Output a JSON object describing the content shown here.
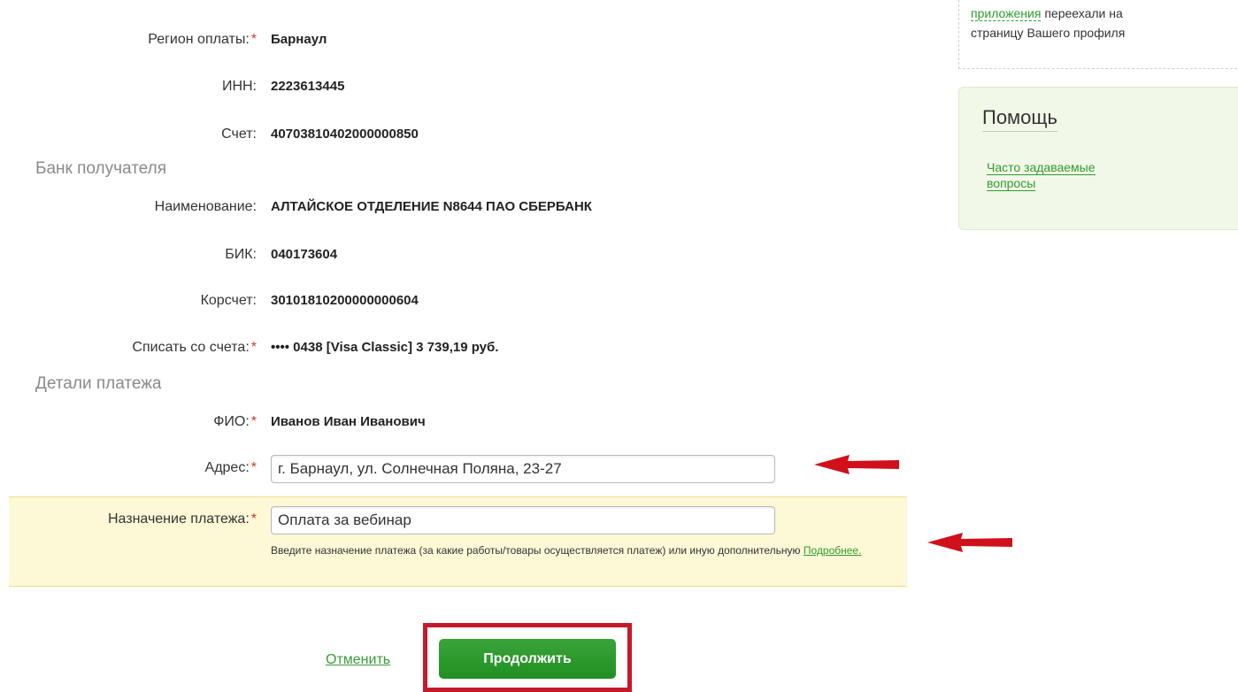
{
  "recipient": {
    "region_label": "Регион оплаты:",
    "region_value": "Барнаул",
    "inn_label": "ИНН:",
    "inn_value": "2223613445",
    "account_label": "Счет:",
    "account_value": "40703810402000000850"
  },
  "bank_section_title": "Банк получателя",
  "bank": {
    "name_label": "Наименование:",
    "name_value": "АЛТАЙСКОЕ ОТДЕЛЕНИЕ N8644 ПАО СБЕРБАНК",
    "bik_label": "БИК:",
    "bik_value": "040173604",
    "corr_label": "Корсчет:",
    "corr_value": "30101810200000000604",
    "debit_label": "Списать со счета:",
    "debit_value": "•••• 0438  [Visa Classic] 3 739,19   руб."
  },
  "details_section_title": "Детали платежа",
  "details": {
    "fio_label": "ФИО:",
    "fio_value": "Иванов Иван Иванович",
    "address_label": "Адрес:",
    "address_value": "г. Барнаул, ул. Солнечная Поляна, 23-27",
    "purpose_label": "Назначение платежа:",
    "purpose_value": "Оплата за вебинар",
    "purpose_hint": "Введите назначение платежа (за какие работы/товары осуществляется платеж) или иную дополнительную",
    "purpose_hint_link": "Подробнее."
  },
  "required_mark": "*",
  "actions": {
    "cancel": "Отменить",
    "continue": "Продолжить"
  },
  "sidebar": {
    "notice_link": "приложения",
    "notice_text_1": " переехали на",
    "notice_text_2": "страницу Вашего профиля",
    "help_title": "Помощь",
    "faq_line1": "Часто задаваемые",
    "faq_line2": "вопросы"
  },
  "colors": {
    "accent_green": "#2e9c2e",
    "button_green": "#218f21",
    "annotation_red": "#d0101a",
    "highlight_yellow": "#fdf8d6"
  },
  "icons": [
    "arrow-left-annotation-icon",
    "arrow-left-annotation-icon"
  ]
}
